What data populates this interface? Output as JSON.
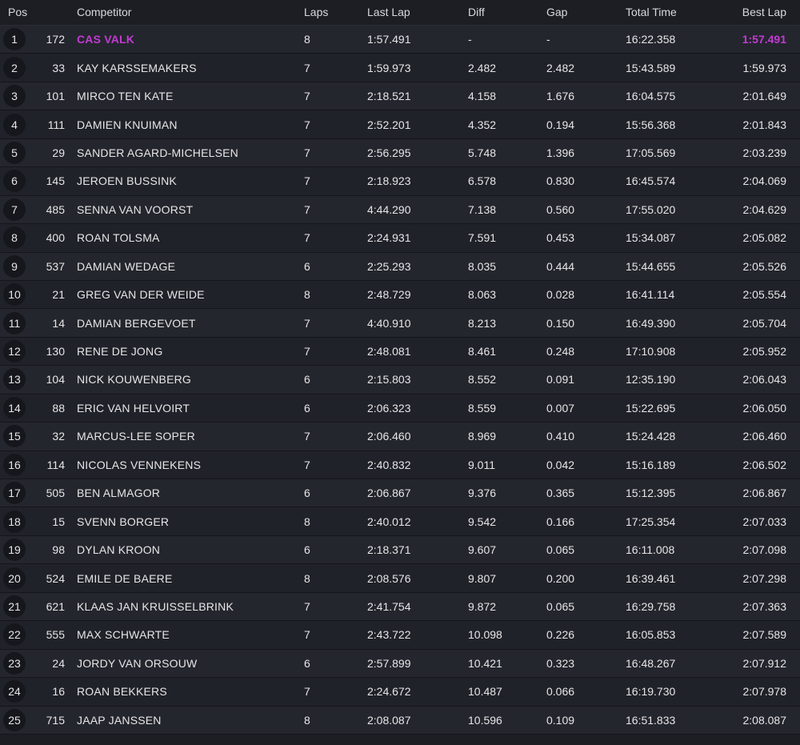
{
  "header": {
    "pos": "Pos",
    "competitor": "Competitor",
    "laps": "Laps",
    "last_lap": "Last Lap",
    "diff": "Diff",
    "gap": "Gap",
    "total_time": "Total Time",
    "best_lap": "Best Lap"
  },
  "colors": {
    "fastest_lap_highlight": "#c23bd4",
    "background": "#1c1e24"
  },
  "rows": [
    {
      "pos": "1",
      "num": "172",
      "name": "CAS VALK",
      "laps": "8",
      "last": "1:57.491",
      "diff": "-",
      "gap": "-",
      "total": "16:22.358",
      "best": "1:57.491",
      "highlight": true
    },
    {
      "pos": "2",
      "num": "33",
      "name": "KAY KARSSEMAKERS",
      "laps": "7",
      "last": "1:59.973",
      "diff": "2.482",
      "gap": "2.482",
      "total": "15:43.589",
      "best": "1:59.973"
    },
    {
      "pos": "3",
      "num": "101",
      "name": "MIRCO TEN KATE",
      "laps": "7",
      "last": "2:18.521",
      "diff": "4.158",
      "gap": "1.676",
      "total": "16:04.575",
      "best": "2:01.649"
    },
    {
      "pos": "4",
      "num": "111",
      "name": "DAMIEN KNUIMAN",
      "laps": "7",
      "last": "2:52.201",
      "diff": "4.352",
      "gap": "0.194",
      "total": "15:56.368",
      "best": "2:01.843"
    },
    {
      "pos": "5",
      "num": "29",
      "name": "SANDER AGARD-MICHELSEN",
      "laps": "7",
      "last": "2:56.295",
      "diff": "5.748",
      "gap": "1.396",
      "total": "17:05.569",
      "best": "2:03.239"
    },
    {
      "pos": "6",
      "num": "145",
      "name": "JEROEN BUSSINK",
      "laps": "7",
      "last": "2:18.923",
      "diff": "6.578",
      "gap": "0.830",
      "total": "16:45.574",
      "best": "2:04.069"
    },
    {
      "pos": "7",
      "num": "485",
      "name": "SENNA VAN VOORST",
      "laps": "7",
      "last": "4:44.290",
      "diff": "7.138",
      "gap": "0.560",
      "total": "17:55.020",
      "best": "2:04.629"
    },
    {
      "pos": "8",
      "num": "400",
      "name": "ROAN TOLSMA",
      "laps": "7",
      "last": "2:24.931",
      "diff": "7.591",
      "gap": "0.453",
      "total": "15:34.087",
      "best": "2:05.082"
    },
    {
      "pos": "9",
      "num": "537",
      "name": "DAMIAN WEDAGE",
      "laps": "6",
      "last": "2:25.293",
      "diff": "8.035",
      "gap": "0.444",
      "total": "15:44.655",
      "best": "2:05.526"
    },
    {
      "pos": "10",
      "num": "21",
      "name": "GREG VAN DER WEIDE",
      "laps": "8",
      "last": "2:48.729",
      "diff": "8.063",
      "gap": "0.028",
      "total": "16:41.114",
      "best": "2:05.554"
    },
    {
      "pos": "11",
      "num": "14",
      "name": "DAMIAN BERGEVOET",
      "laps": "7",
      "last": "4:40.910",
      "diff": "8.213",
      "gap": "0.150",
      "total": "16:49.390",
      "best": "2:05.704"
    },
    {
      "pos": "12",
      "num": "130",
      "name": "RENE DE JONG",
      "laps": "7",
      "last": "2:48.081",
      "diff": "8.461",
      "gap": "0.248",
      "total": "17:10.908",
      "best": "2:05.952"
    },
    {
      "pos": "13",
      "num": "104",
      "name": "NICK KOUWENBERG",
      "laps": "6",
      "last": "2:15.803",
      "diff": "8.552",
      "gap": "0.091",
      "total": "12:35.190",
      "best": "2:06.043"
    },
    {
      "pos": "14",
      "num": "88",
      "name": "ERIC VAN HELVOIRT",
      "laps": "6",
      "last": "2:06.323",
      "diff": "8.559",
      "gap": "0.007",
      "total": "15:22.695",
      "best": "2:06.050"
    },
    {
      "pos": "15",
      "num": "32",
      "name": "MARCUS-LEE SOPER",
      "laps": "7",
      "last": "2:06.460",
      "diff": "8.969",
      "gap": "0.410",
      "total": "15:24.428",
      "best": "2:06.460"
    },
    {
      "pos": "16",
      "num": "114",
      "name": "NICOLAS VENNEKENS",
      "laps": "7",
      "last": "2:40.832",
      "diff": "9.011",
      "gap": "0.042",
      "total": "15:16.189",
      "best": "2:06.502"
    },
    {
      "pos": "17",
      "num": "505",
      "name": "BEN ALMAGOR",
      "laps": "6",
      "last": "2:06.867",
      "diff": "9.376",
      "gap": "0.365",
      "total": "15:12.395",
      "best": "2:06.867"
    },
    {
      "pos": "18",
      "num": "15",
      "name": "SVENN BORGER",
      "laps": "8",
      "last": "2:40.012",
      "diff": "9.542",
      "gap": "0.166",
      "total": "17:25.354",
      "best": "2:07.033"
    },
    {
      "pos": "19",
      "num": "98",
      "name": "DYLAN KROON",
      "laps": "6",
      "last": "2:18.371",
      "diff": "9.607",
      "gap": "0.065",
      "total": "16:11.008",
      "best": "2:07.098"
    },
    {
      "pos": "20",
      "num": "524",
      "name": "EMILE DE BAERE",
      "laps": "8",
      "last": "2:08.576",
      "diff": "9.807",
      "gap": "0.200",
      "total": "16:39.461",
      "best": "2:07.298"
    },
    {
      "pos": "21",
      "num": "621",
      "name": "KLAAS JAN KRUISSELBRINK",
      "laps": "7",
      "last": "2:41.754",
      "diff": "9.872",
      "gap": "0.065",
      "total": "16:29.758",
      "best": "2:07.363"
    },
    {
      "pos": "22",
      "num": "555",
      "name": "MAX SCHWARTE",
      "laps": "7",
      "last": "2:43.722",
      "diff": "10.098",
      "gap": "0.226",
      "total": "16:05.853",
      "best": "2:07.589"
    },
    {
      "pos": "23",
      "num": "24",
      "name": "JORDY VAN ORSOUW",
      "laps": "6",
      "last": "2:57.899",
      "diff": "10.421",
      "gap": "0.323",
      "total": "16:48.267",
      "best": "2:07.912"
    },
    {
      "pos": "24",
      "num": "16",
      "name": "ROAN BEKKERS",
      "laps": "7",
      "last": "2:24.672",
      "diff": "10.487",
      "gap": "0.066",
      "total": "16:19.730",
      "best": "2:07.978"
    },
    {
      "pos": "25",
      "num": "715",
      "name": "JAAP JANSSEN",
      "laps": "8",
      "last": "2:08.087",
      "diff": "10.596",
      "gap": "0.109",
      "total": "16:51.833",
      "best": "2:08.087"
    }
  ]
}
